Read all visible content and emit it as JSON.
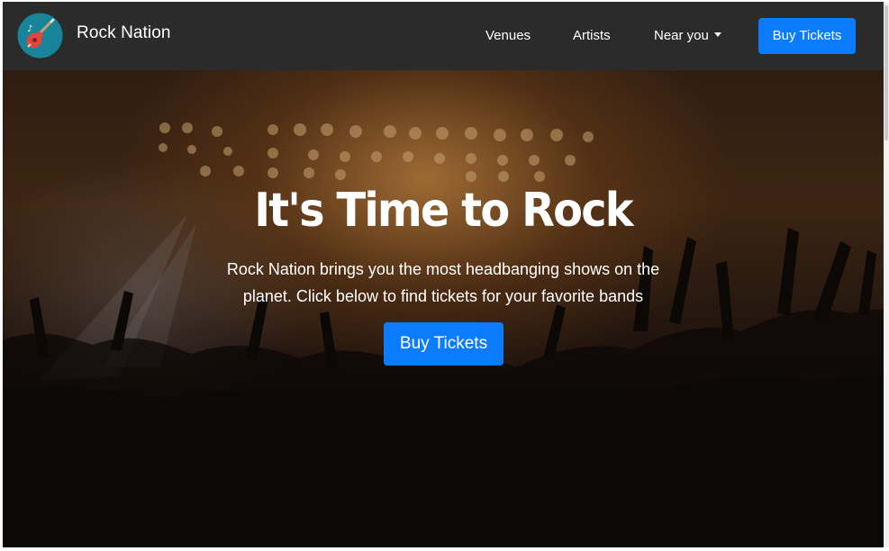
{
  "brand": {
    "name": "Rock Nation",
    "logo_icon": "guitar-icon"
  },
  "nav": {
    "links": [
      "Venues",
      "Artists",
      "Near you"
    ],
    "cta": "Buy Tickets"
  },
  "hero": {
    "title": "It's Time to Rock",
    "subtitle_line1": "Rock Nation brings you the most headbanging shows on the",
    "subtitle_line2": "planet. Click below to find tickets for your favorite bands",
    "cta": "Buy Tickets"
  },
  "colors": {
    "navbar": "#2b2b2b",
    "primary": "#0b7cff",
    "logo_circle": "#18849a"
  }
}
